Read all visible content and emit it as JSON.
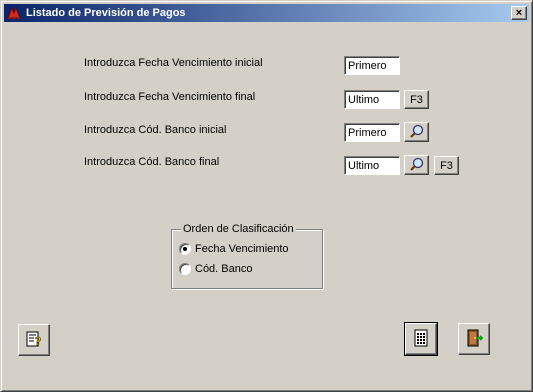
{
  "window": {
    "title": "Listado de Previsión de Pagos",
    "close_glyph": "×"
  },
  "form": {
    "rows": [
      {
        "label": "Introduzca Fecha Vencimiento inicial",
        "value": "Primero"
      },
      {
        "label": "Introduzca Fecha Vencimiento final",
        "value": "Ultimo",
        "button": "F3"
      },
      {
        "label": "Introduzca Cód. Banco inicial",
        "value": "Primero",
        "icon": "magnifier-icon"
      },
      {
        "label": "Introduzca Cód. Banco final",
        "value": "Ultimo",
        "icon": "magnifier-icon",
        "button": "F3"
      }
    ]
  },
  "sort_group": {
    "title": "Orden de Clasificación",
    "options": [
      {
        "label": "Fecha Vencimiento",
        "selected": true
      },
      {
        "label": "Cód. Banco",
        "selected": false
      }
    ]
  },
  "bottom_buttons": {
    "help_icon": "help-document-icon",
    "print_icon": "calculator-list-icon",
    "exit_icon": "exit-door-icon"
  },
  "colors": {
    "face": "#d4d0c8",
    "title_start": "#0a246a",
    "title_end": "#a6caf0"
  }
}
